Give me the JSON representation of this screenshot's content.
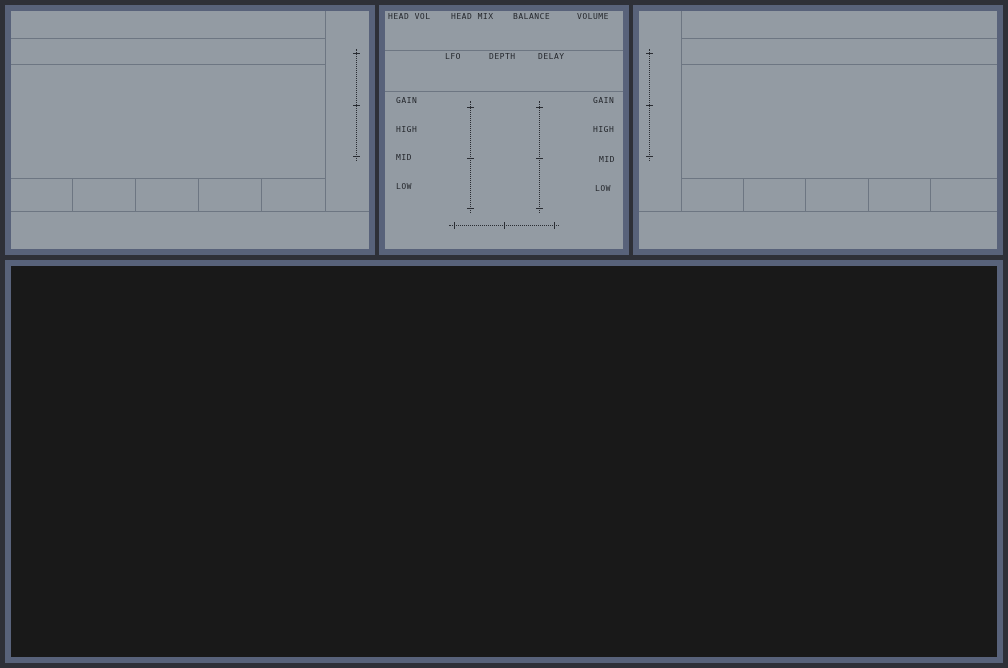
{
  "mixer": {
    "top_labels": [
      "HEAD VOL",
      "HEAD MIX",
      "BALANCE",
      "VOLUME"
    ],
    "fx_labels": [
      "LFO",
      "DEPTH",
      "DELAY"
    ],
    "eq_left": [
      "GAIN",
      "HIGH",
      "MID",
      "LOW"
    ],
    "eq_right": [
      "GAIN",
      "HIGH",
      "MID",
      "LOW"
    ]
  },
  "colors": {
    "background": "#2e3038",
    "frame": "#58627a",
    "panel": "#939ba3",
    "playlist": "#191919"
  }
}
